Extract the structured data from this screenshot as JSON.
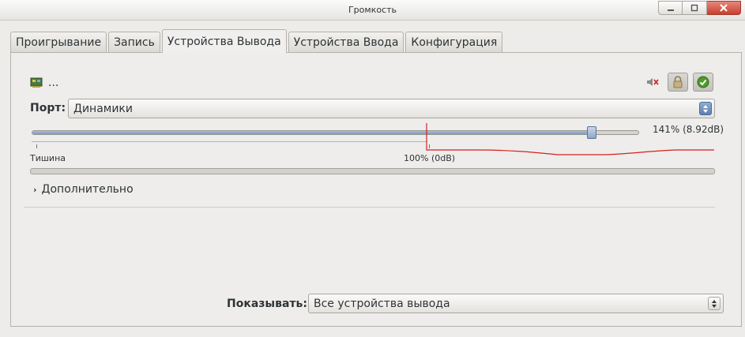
{
  "window": {
    "title": "Громкость"
  },
  "tabs": [
    {
      "label": "Проигрывание",
      "active": false
    },
    {
      "label": "Запись",
      "active": false
    },
    {
      "label": "Устройства Вывода",
      "active": true
    },
    {
      "label": "Устройства Ввода",
      "active": false
    },
    {
      "label": "Конфигурация",
      "active": false
    }
  ],
  "device": {
    "name": "...",
    "icon": "sound-card-icon"
  },
  "port": {
    "label": "Порт:",
    "value": "Динамики"
  },
  "volume": {
    "value_text": "141% (8.92dB)",
    "level_percent": 141,
    "max_percent": 153,
    "min_label": "Тишина",
    "mid_label": "100% (0dB)"
  },
  "advanced": {
    "label": "Дополнительно"
  },
  "filter": {
    "label": "Показывать:",
    "value": "Все устройства вывода"
  },
  "colors": {
    "annotation": "#d62020",
    "accent": "#7e9ac2"
  }
}
